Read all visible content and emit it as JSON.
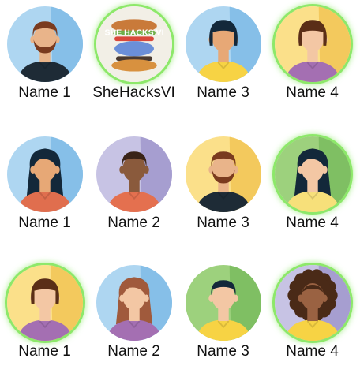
{
  "rows": [
    [
      {
        "label": "Name 1",
        "selected": false,
        "avatar": {
          "icon": "man-beard-avatar-icon",
          "bg": "#aed6f1",
          "shade": "#86bfe8",
          "skin": "#e9b48a",
          "hair": "#7a3b1f",
          "hair_style": "short",
          "beard": true,
          "shirt": "#1e2b36"
        }
      },
      {
        "label": "SheHacksVI",
        "selected": true,
        "avatar": {
          "icon": "shehacks-logo-icon",
          "bg": "#f2efe6",
          "logo_text": "SHE HACKS VI"
        }
      },
      {
        "label": "Name 3",
        "selected": false,
        "avatar": {
          "icon": "woman-short-hair-avatar-icon",
          "bg": "#aed6f1",
          "shade": "#86bfe8",
          "skin": "#e7a876",
          "hair": "#13283a",
          "hair_style": "bob",
          "beard": false,
          "shirt": "#f7d344"
        }
      },
      {
        "label": "Name 4",
        "selected": true,
        "avatar": {
          "icon": "woman-bangs-avatar-icon",
          "bg": "#fbe08a",
          "shade": "#f3c95d",
          "skin": "#f3c7a4",
          "hair": "#5a2e17",
          "hair_style": "bob",
          "beard": false,
          "shirt": "#a46fb2"
        }
      }
    ],
    [
      {
        "label": "Name 1",
        "selected": false,
        "avatar": {
          "icon": "woman-long-hair-avatar-icon",
          "bg": "#aed6f1",
          "shade": "#86bfe8",
          "skin": "#e7a876",
          "hair": "#13283a",
          "hair_style": "long",
          "beard": false,
          "shirt": "#e06e4e"
        }
      },
      {
        "label": "Name 2",
        "selected": false,
        "avatar": {
          "icon": "man-avatar-icon",
          "bg": "#c7c3e4",
          "shade": "#a69ed0",
          "skin": "#8a5a3c",
          "hair": "#3a2418",
          "hair_style": "short",
          "beard": false,
          "shirt": "#e4704f"
        }
      },
      {
        "label": "Name 3",
        "selected": false,
        "avatar": {
          "icon": "man-beard-avatar-icon",
          "bg": "#fbe08a",
          "shade": "#f3c95d",
          "skin": "#e9b48a",
          "hair": "#7a3b1f",
          "hair_style": "short",
          "beard": true,
          "shirt": "#1e2b36"
        }
      },
      {
        "label": "Name 4",
        "selected": true,
        "avatar": {
          "icon": "woman-long-hair-avatar-icon",
          "bg": "#9dd17d",
          "shade": "#7fbf63",
          "skin": "#f3c7a4",
          "hair": "#13283a",
          "hair_style": "long",
          "beard": false,
          "shirt": "#f7e07a"
        }
      }
    ],
    [
      {
        "label": "Name 1",
        "selected": true,
        "avatar": {
          "icon": "woman-bangs-avatar-icon",
          "bg": "#fbe08a",
          "shade": "#f3c95d",
          "skin": "#f3c7a4",
          "hair": "#5a2e17",
          "hair_style": "bob",
          "beard": false,
          "shirt": "#a46fb2"
        }
      },
      {
        "label": "Name 2",
        "selected": false,
        "avatar": {
          "icon": "woman-wavy-hair-avatar-icon",
          "bg": "#aed6f1",
          "shade": "#86bfe8",
          "skin": "#f3c7a4",
          "hair": "#a05a3c",
          "hair_style": "long",
          "beard": false,
          "shirt": "#a46fb2"
        }
      },
      {
        "label": "Name 3",
        "selected": false,
        "avatar": {
          "icon": "man-avatar-icon",
          "bg": "#9dd17d",
          "shade": "#7fbf63",
          "skin": "#f3c7a4",
          "hair": "#13283a",
          "hair_style": "short",
          "beard": false,
          "shirt": "#f7d344"
        }
      },
      {
        "label": "Name 4",
        "selected": true,
        "avatar": {
          "icon": "woman-curly-hair-avatar-icon",
          "bg": "#c7c3e4",
          "shade": "#a69ed0",
          "skin": "#9a6242",
          "hair": "#4a2a17",
          "hair_style": "curly",
          "beard": false,
          "shirt": "#f7d344"
        }
      }
    ]
  ]
}
